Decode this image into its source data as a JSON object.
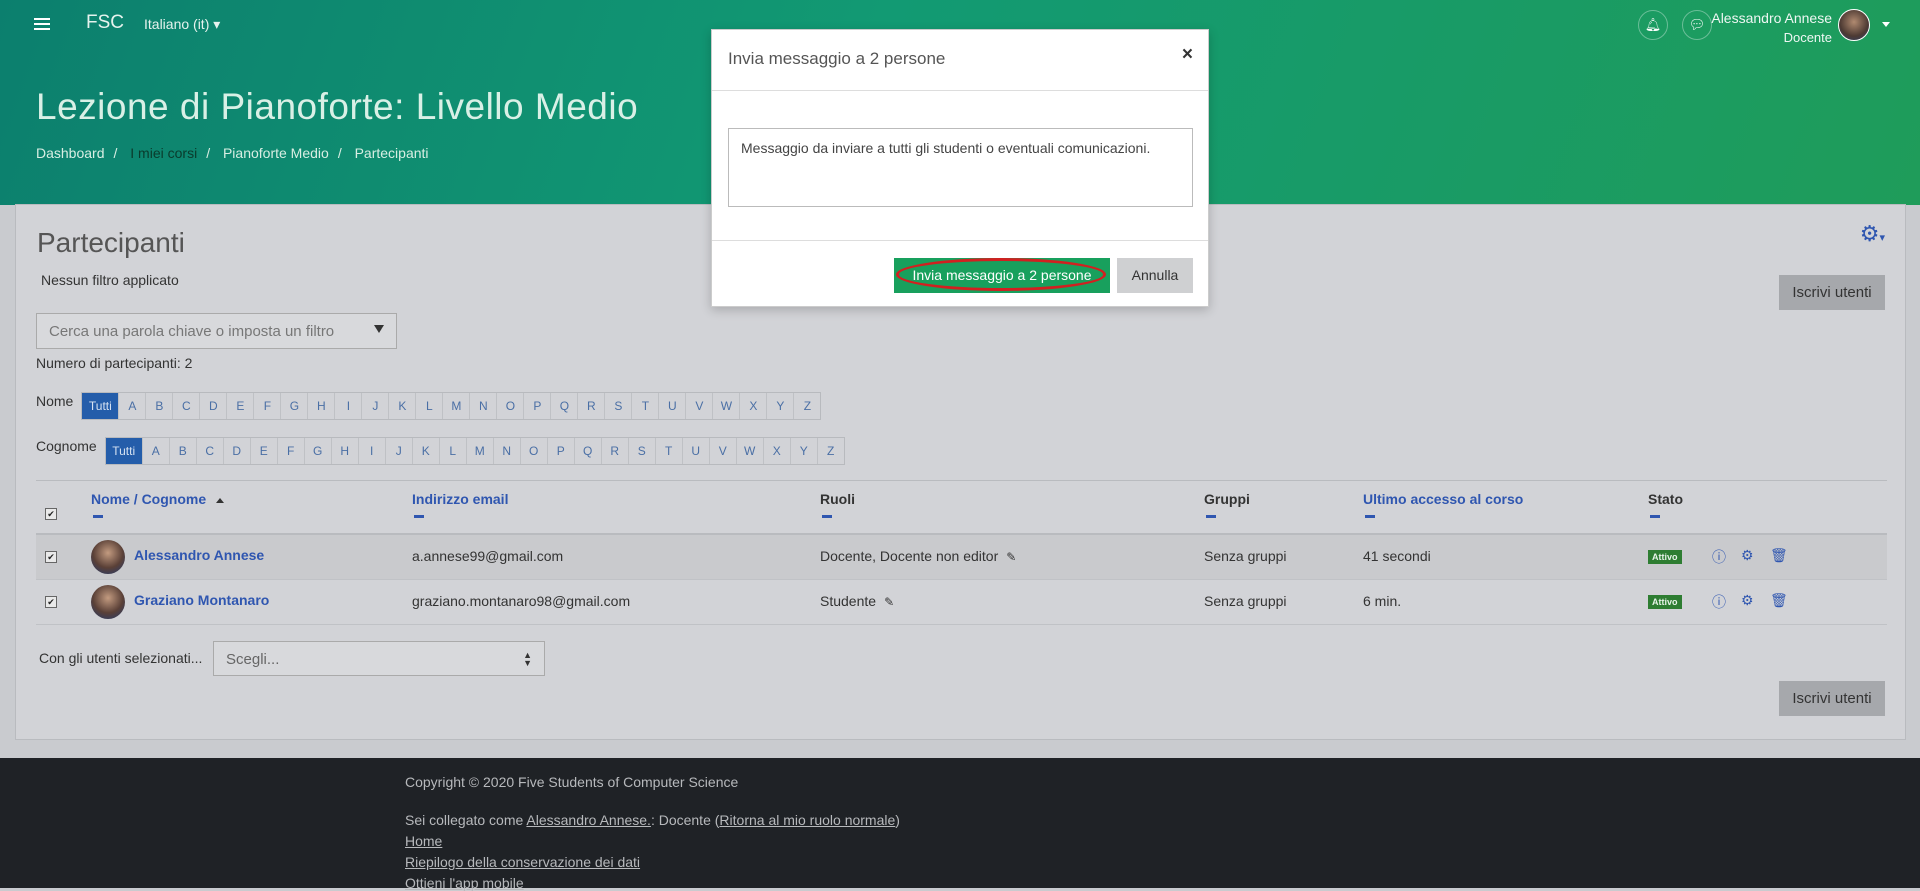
{
  "header": {
    "brand": "FSC",
    "language": "Italiano (it)",
    "user_name": "Alessandro Annese",
    "user_role": "Docente",
    "course_title": "Lezione di Pianoforte: Livello Medio",
    "breadcrumb": [
      "Dashboard",
      "I miei corsi",
      "Pianoforte Medio",
      "Partecipanti"
    ],
    "bg_color": "#0f8a6d"
  },
  "participants": {
    "title": "Partecipanti",
    "no_filter": "Nessun filtro applicato",
    "search_placeholder": "Cerca una parola chiave o imposta un filtro",
    "count_text": "Numero di partecipanti: 2",
    "enrol_button": "Iscrivi utenti",
    "first_name_label": "Nome",
    "last_name_label": "Cognome",
    "all_label": "Tutti",
    "letters": [
      "A",
      "B",
      "C",
      "D",
      "E",
      "F",
      "G",
      "H",
      "I",
      "J",
      "K",
      "L",
      "M",
      "N",
      "O",
      "P",
      "Q",
      "R",
      "S",
      "T",
      "U",
      "V",
      "W",
      "X",
      "Y",
      "Z"
    ],
    "columns": {
      "name": "Nome / Cognome",
      "email": "Indirizzo email",
      "roles": "Ruoli",
      "groups": "Gruppi",
      "last_access": "Ultimo accesso al corso",
      "status": "Stato"
    },
    "rows": [
      {
        "name": "Alessandro Annese",
        "email": "a.annese99@gmail.com",
        "roles": "Docente, Docente non editor",
        "groups": "Senza gruppi",
        "last_access": "41 secondi",
        "status": "Attivo"
      },
      {
        "name": "Graziano Montanaro",
        "email": "graziano.montanaro98@gmail.com",
        "roles": "Studente",
        "groups": "Senza gruppi",
        "last_access": "6 min.",
        "status": "Attivo"
      }
    ],
    "with_selected_label": "Con gli utenti selezionati...",
    "with_selected_value": "Scegli..."
  },
  "footer": {
    "copyright": "Copyright © 2020 Five Students of Computer Science",
    "logged_prefix": "Sei collegato come ",
    "logged_user": "Alessandro Annese.",
    "logged_role": ": Docente (",
    "return_role": "Ritorna al mio ruolo normale",
    "logged_suffix": ")",
    "home": "Home",
    "data_retention": "Riepilogo della conservazione dei dati",
    "mobile_app": "Ottieni l'app mobile"
  },
  "dialog": {
    "title": "Invia messaggio a 2 persone",
    "close": "×",
    "message": "Messaggio da inviare a tutti gli studenti o eventuali comunicazioni.",
    "send_button": "Invia messaggio a 2 persone",
    "cancel_button": "Annulla",
    "send_color": "#18a05d",
    "highlight_color": "#d12020"
  }
}
